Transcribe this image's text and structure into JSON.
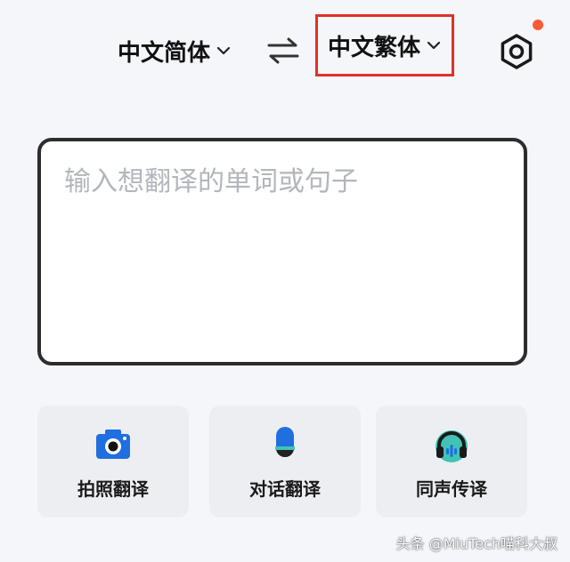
{
  "header": {
    "source_language": "中文简体",
    "target_language": "中文繁体"
  },
  "input": {
    "placeholder": "输入想翻译的单词或句子",
    "value": ""
  },
  "actions": [
    {
      "label": "拍照翻译",
      "icon": "camera-icon"
    },
    {
      "label": "对话翻译",
      "icon": "microphone-icon"
    },
    {
      "label": "同声传译",
      "icon": "headphones-icon"
    }
  ],
  "watermark": "头条 @MiuTech喵科大叔",
  "colors": {
    "highlight": "#e0312a",
    "accent_blue": "#1f6fe0",
    "accent_teal": "#41c3b6",
    "badge": "#ff5a35"
  }
}
